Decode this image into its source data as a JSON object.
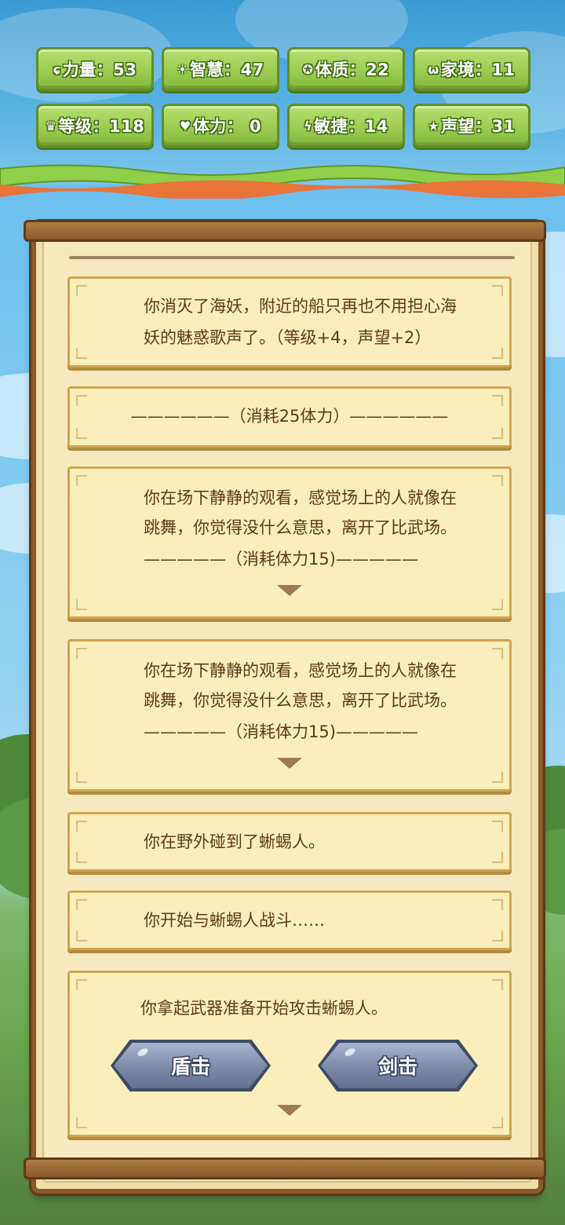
{
  "stats": [
    {
      "icon": "strength-icon",
      "glyph": "ɕ",
      "label": "力量：53"
    },
    {
      "icon": "sun-icon",
      "glyph": "☀",
      "label": "智慧：47"
    },
    {
      "icon": "refresh-icon",
      "glyph": "✪",
      "label": "体质：22"
    },
    {
      "icon": "family-icon",
      "glyph": "ω",
      "label": "家境：11"
    },
    {
      "icon": "crown-icon",
      "glyph": "♛",
      "label": "等级：118"
    },
    {
      "icon": "heart-icon",
      "glyph": "♥",
      "label": "体力：  0"
    },
    {
      "icon": "lightning-icon",
      "glyph": "ϟ",
      "label": "敏捷：14"
    },
    {
      "icon": "star-icon",
      "glyph": "★",
      "label": "声望：31"
    }
  ],
  "log": {
    "card1": {
      "line1": "你消灭了海妖，附近的船只再也不用担心海",
      "line2": "妖的魅惑歌声了。（等级+4，声望+2）"
    },
    "card2": {
      "line1": "——————（消耗25体力）——————"
    },
    "card3": {
      "line1": "你在场下静静的观看，感觉场上的人就像在",
      "line2": "跳舞，你觉得没什么意思，离开了比武场。",
      "line3": "—————（消耗体力15)—————"
    },
    "card4": {
      "line1": "你在场下静静的观看，感觉场上的人就像在",
      "line2": "跳舞，你觉得没什么意思，离开了比武场。",
      "line3": "—————（消耗体力15)—————"
    },
    "card5": {
      "line1": "你在野外碰到了蜥蜴人。"
    },
    "card6": {
      "line1": "你开始与蜥蜴人战斗……"
    },
    "card7": {
      "line1": "你拿起武器准备开始攻击蜥蜴人。"
    }
  },
  "actions": {
    "shield_label": "盾击",
    "sword_label": "剑击"
  }
}
